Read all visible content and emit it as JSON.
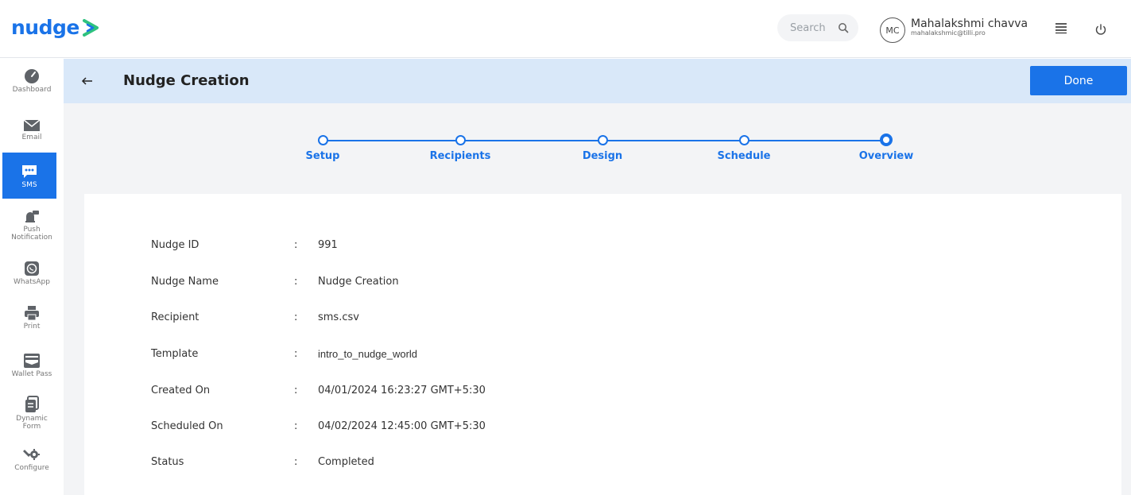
{
  "header": {
    "logo_text": "nudge",
    "search_placeholder": "Search",
    "avatar_initials": "MC",
    "user_name": "Mahalakshmi chavva",
    "user_email": "mahalakshmic@tilli.pro"
  },
  "sidebar": {
    "items": [
      {
        "label": "Dashboard",
        "icon": "dashboard-icon"
      },
      {
        "label": "Email",
        "icon": "email-icon"
      },
      {
        "label": "SMS",
        "icon": "sms-icon",
        "active": true
      },
      {
        "label": "Push Notification",
        "icon": "push-notification-icon"
      },
      {
        "label": "WhatsApp",
        "icon": "whatsapp-icon"
      },
      {
        "label": "Print",
        "icon": "print-icon"
      },
      {
        "label": "Wallet Pass",
        "icon": "wallet-pass-icon"
      },
      {
        "label": "Dynamic Form",
        "icon": "dynamic-form-icon"
      },
      {
        "label": "Configure",
        "icon": "configure-icon"
      }
    ]
  },
  "page": {
    "title": "Nudge Creation",
    "done_label": "Done"
  },
  "steps": [
    {
      "label": "Setup"
    },
    {
      "label": "Recipients"
    },
    {
      "label": "Design"
    },
    {
      "label": "Schedule"
    },
    {
      "label": "Overview",
      "current": true
    }
  ],
  "overview": {
    "separator": ":",
    "rows": [
      {
        "key": "Nudge ID",
        "value": "991"
      },
      {
        "key": "Nudge Name",
        "value": "Nudge Creation"
      },
      {
        "key": "Recipient",
        "value": "sms.csv"
      },
      {
        "key": "Template",
        "value": "intro_to_nudge_world"
      },
      {
        "key": "Created On",
        "value": "04/01/2024 16:23:27 GMT+5:30"
      },
      {
        "key": "Scheduled On",
        "value": "04/02/2024 12:45:00 GMT+5:30"
      },
      {
        "key": "Status",
        "value": "Completed"
      }
    ]
  },
  "colors": {
    "accent": "#1a73e8",
    "title_bar": "#d9e8f9",
    "content_bg": "#f3f4f6"
  }
}
